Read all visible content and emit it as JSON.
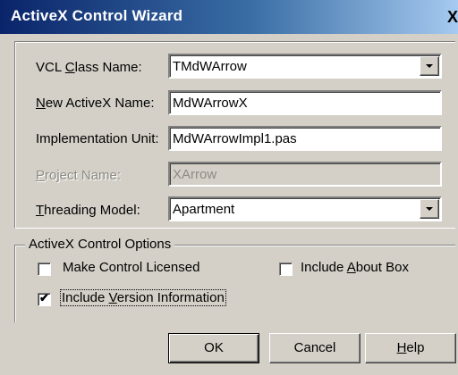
{
  "window": {
    "title": "ActiveX Control Wizard",
    "close_glyph": "X"
  },
  "form": {
    "vcl_class": {
      "label_pre": "VCL ",
      "label_key": "C",
      "label_post": "lass Name:",
      "value": "TMdWArrow"
    },
    "new_name": {
      "label_pre": "",
      "label_key": "N",
      "label_post": "ew ActiveX Name:",
      "value": "MdWArrowX"
    },
    "impl_unit": {
      "label_pre": "Implementation Unit:",
      "value": "MdWArrowImpl1.pas"
    },
    "project_name": {
      "label_pre": "",
      "label_key": "P",
      "label_post": "roject Name:",
      "value": "XArrow"
    },
    "threading": {
      "label_pre": "",
      "label_key": "T",
      "label_post": "hreading Model:",
      "value": "Apartment"
    }
  },
  "options": {
    "group_title": "ActiveX Control Options",
    "licensed": {
      "label": "Make Control Licensed",
      "checked": false
    },
    "about_box": {
      "label_pre": "Include ",
      "label_key": "A",
      "label_post": "bout Box",
      "checked": false
    },
    "version_info": {
      "label_pre": "Include ",
      "label_key": "V",
      "label_post": "ersion Information",
      "checked": true,
      "mark": "✔"
    }
  },
  "buttons": {
    "ok": "OK",
    "cancel": "Cancel",
    "help_key": "H",
    "help_post": "elp"
  },
  "icons": {
    "dropdown": "chevron-down-icon",
    "close": "close-icon",
    "check": "check-icon"
  }
}
